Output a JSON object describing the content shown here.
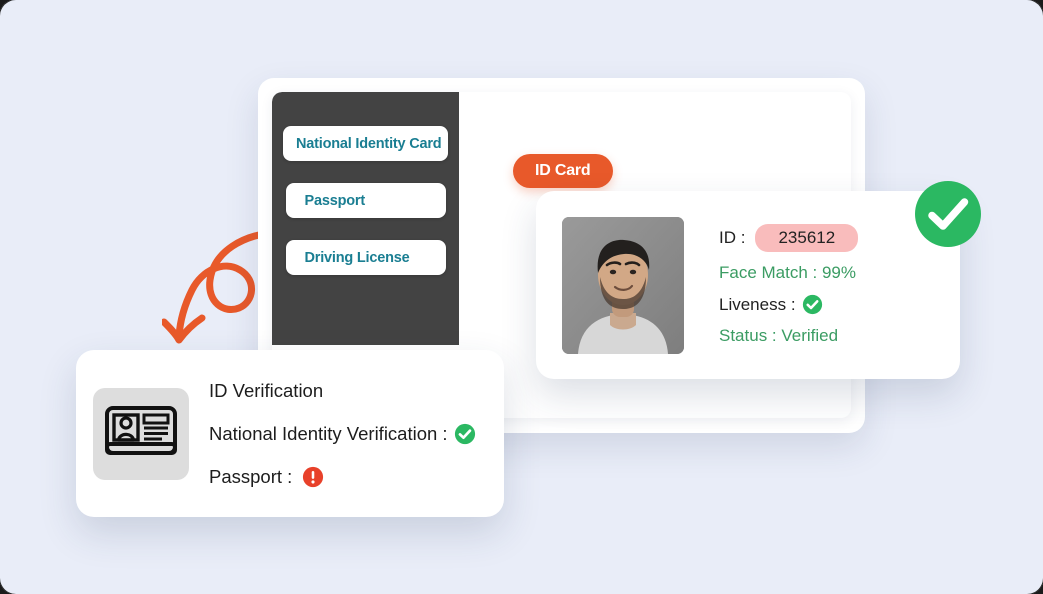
{
  "page": {
    "background_color": "#e9edf8",
    "accent_orange": "#e8592a",
    "accent_teal": "#1a7e92",
    "accent_green": "#2bb862",
    "sidebar_color": "#434343"
  },
  "window": {
    "sidebar": {
      "items": [
        {
          "label": "National Identity Card",
          "name": "nav-national-identity-card"
        },
        {
          "label": "Passport",
          "name": "nav-passport"
        },
        {
          "label": "Driving License",
          "name": "nav-driving-license"
        }
      ]
    },
    "content": {
      "pill_label": "ID Card"
    }
  },
  "detail_card": {
    "photo_alt": "applicant-portrait-photo",
    "id_label": "ID :",
    "id_value": "235612",
    "face_match": "Face Match : 99%",
    "liveness_label": "Liveness :",
    "liveness_icon": "green-check-icon",
    "status": "Status : Verified"
  },
  "badge": {
    "icon": "green-check-badge-icon"
  },
  "verify_card": {
    "icon": "id-card-icon",
    "title": "ID  Verification",
    "rows": [
      {
        "label": "National Identity Verification :",
        "icon": "green-check-icon"
      },
      {
        "label": "Passport :",
        "icon": "red-alert-icon"
      }
    ]
  },
  "decoration": {
    "arrow": "curved-loop-arrow"
  }
}
